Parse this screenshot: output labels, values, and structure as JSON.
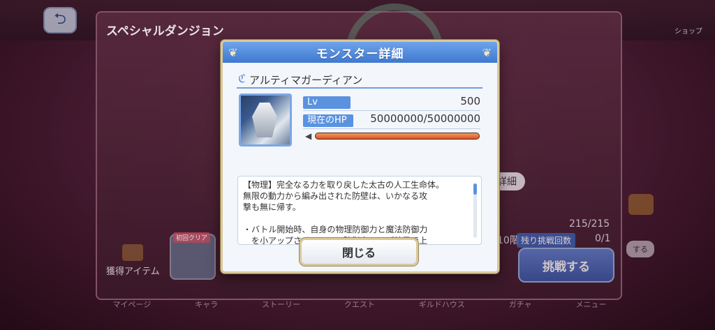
{
  "header": {
    "title": "スペシャルダンジョン",
    "top_right_label": "ショップ"
  },
  "background": {
    "detail_label": "詳細",
    "stamina": "215/215",
    "floor": "10階",
    "remaining_label": "残り挑戦回数",
    "remaining_value": "0/1",
    "challenge_label": "挑戦する",
    "reward_label": "獲得アイテム",
    "first_clear_label": "初回クリア",
    "right_button_label": "する",
    "tabs": [
      "マイページ",
      "キャラ",
      "ストーリー",
      "クエスト",
      "ギルドハウス",
      "ガチャ",
      "メニュー"
    ]
  },
  "modal": {
    "title": "モンスター詳細",
    "monster_name": "アルティマガーディアン",
    "level_label": "Lv",
    "level_value": "500",
    "hp_label": "現在のHP",
    "hp_value": "50000000/50000000",
    "hp_fraction": 1.0,
    "description": "【物理】完全なる力を取り戻した太古の人工生命体。\n無限の動力から編み出された防壁は、いかなる攻\n撃も無に帰す。\n\n・バトル開始時、自身の物理防御力と魔法防御力\n　を小アップさせる。この防御力アップ効果で上\n　昇した防御力は、バトル中に受ける防御力ダウ",
    "close_label": "閉じる"
  },
  "colors": {
    "modal_header": "#4f86dc",
    "hp_bar": "#e0663a",
    "stat_label_bg": "#5a92e0"
  }
}
